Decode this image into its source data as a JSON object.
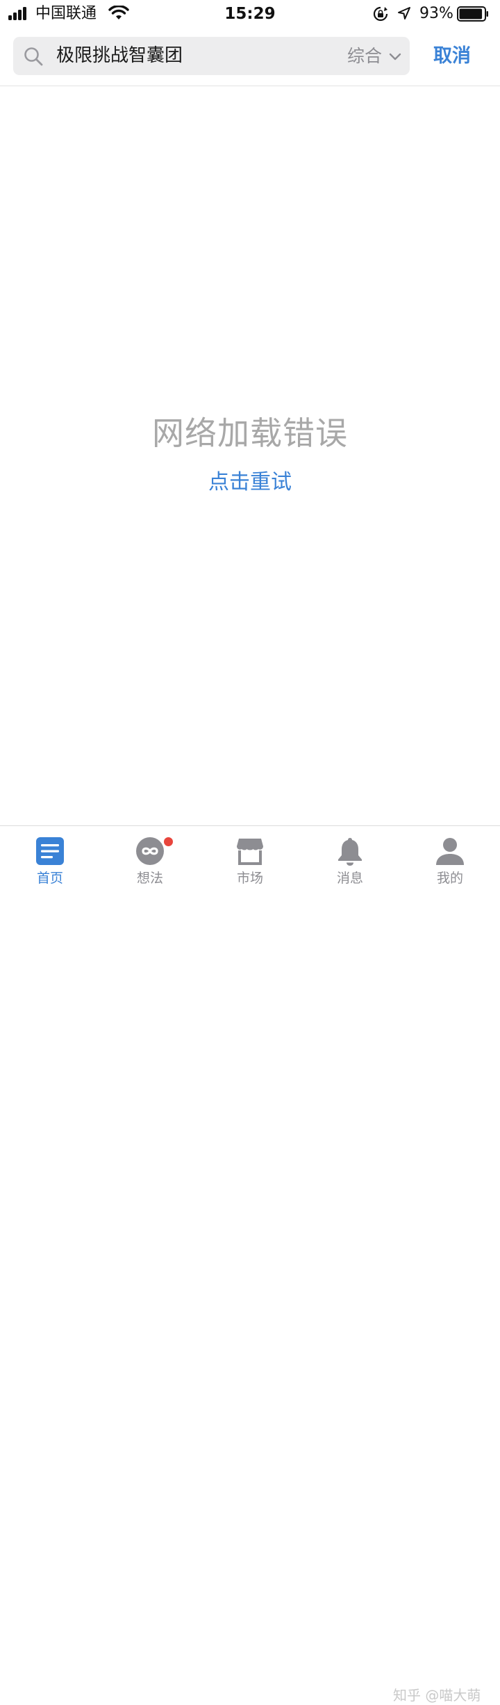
{
  "status_bar": {
    "carrier": "中国联通",
    "time": "15:29",
    "battery_percent": "93%",
    "battery_level": 0.93,
    "icons": [
      "signal-icon",
      "wifi-icon",
      "rotation-lock-icon",
      "location-icon",
      "battery-icon"
    ]
  },
  "search": {
    "query": "极限挑战智囊团",
    "filter_label": "综合",
    "cancel_label": "取消",
    "icon": "search-icon"
  },
  "error": {
    "message": "网络加载错误",
    "retry_label": "点击重试"
  },
  "tab_bar": {
    "tabs": [
      {
        "label": "首页",
        "icon": "home-feed-icon",
        "active": true
      },
      {
        "label": "想法",
        "icon": "ideas-icon",
        "active": false,
        "badge": true
      },
      {
        "label": "市场",
        "icon": "market-icon",
        "active": false
      },
      {
        "label": "消息",
        "icon": "bell-icon",
        "active": false
      },
      {
        "label": "我的",
        "icon": "profile-icon",
        "active": false
      }
    ]
  },
  "watermark": "知乎 @喵大萌",
  "colors": {
    "accent": "#3a82d6",
    "muted_text": "#8d8d92",
    "error_text": "#a8a8a8",
    "search_background": "#ededee",
    "badge": "#e8453c"
  }
}
